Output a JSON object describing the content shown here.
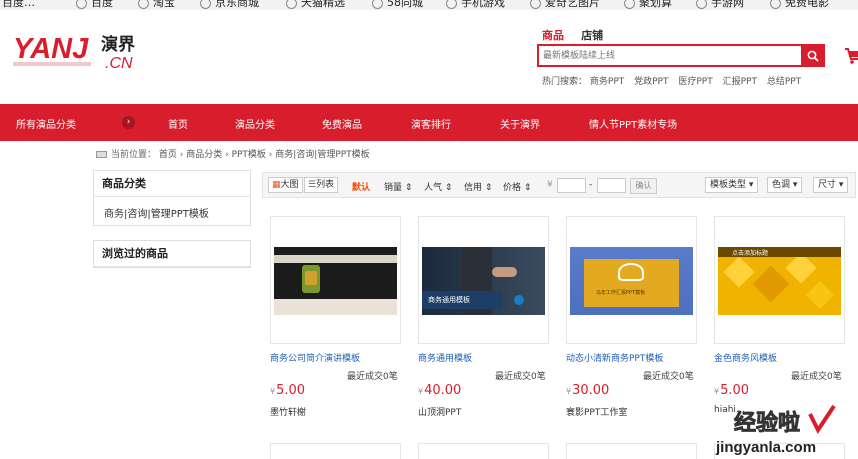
{
  "bookmarks": [
    "百度…",
    "百度",
    "淘宝",
    "京东商城",
    "天猫精选",
    "58同城",
    "手机游戏",
    "爱奇艺图片",
    "聚划算",
    "手游网",
    "免费电影"
  ],
  "logo": {
    "text": "YANJ",
    "cn_text": "演界",
    "suffix": ".CN"
  },
  "search": {
    "tab_goods": "商品",
    "tab_store": "店铺",
    "placeholder": "最新模板陆续上线",
    "hot_label": "热门搜索：",
    "hot_links": [
      "商务PPT",
      "党政PPT",
      "医疗PPT",
      "汇报PPT",
      "总结PPT"
    ]
  },
  "nav": {
    "items": [
      "所有演品分类",
      "首页",
      "演品分类",
      "免费演品",
      "演客排行",
      "关于演界",
      "情人节PPT素材专场"
    ]
  },
  "breadcrumb": {
    "label": "当前位置：",
    "items": [
      "首页",
      "商品分类",
      "PPT模板",
      "商务|咨询|管理PPT模板"
    ]
  },
  "sidebar": {
    "category_title": "商品分类",
    "category_link": "商务|咨询|管理PPT模板",
    "history_title": "浏览过的商品"
  },
  "filter": {
    "view_grid": "大图",
    "view_list": "列表",
    "sort_default": "默认",
    "sort_sales": "销量",
    "sort_popularity": "人气",
    "sort_credit": "信用",
    "sort_price": "价格",
    "currency": "¥",
    "dash": "-",
    "confirm": "确认",
    "template_type": "模板类型",
    "color": "色调",
    "size": "尺寸"
  },
  "products": [
    {
      "title": "商务公司简介演讲模板",
      "sales": "最近成交0笔",
      "price": "5.00",
      "shop": "墨竹轩榭",
      "thumb_text": ""
    },
    {
      "title": "商务通用模板",
      "sales": "最近成交0笔",
      "price": "40.00",
      "shop": "山顶洞PPT",
      "thumb_text": "商务通用模板"
    },
    {
      "title": "动态小清新商务PPT模板",
      "sales": "最近成交0笔",
      "price": "30.00",
      "shop": "寰影PPT工作室",
      "thumb_text": "马年工作汇报PPT模板"
    },
    {
      "title": "金色商务风模板",
      "sales": "最近成交0笔",
      "price": "5.00",
      "shop": "hiahi…",
      "thumb_text": "点击添加标题"
    }
  ],
  "watermark": {
    "text": "经验啦",
    "url": "jingyanla.com"
  },
  "colors": {
    "brand_red": "#d81e2c",
    "link_blue": "#1f5fb5",
    "sort_active": "#e8541b"
  }
}
